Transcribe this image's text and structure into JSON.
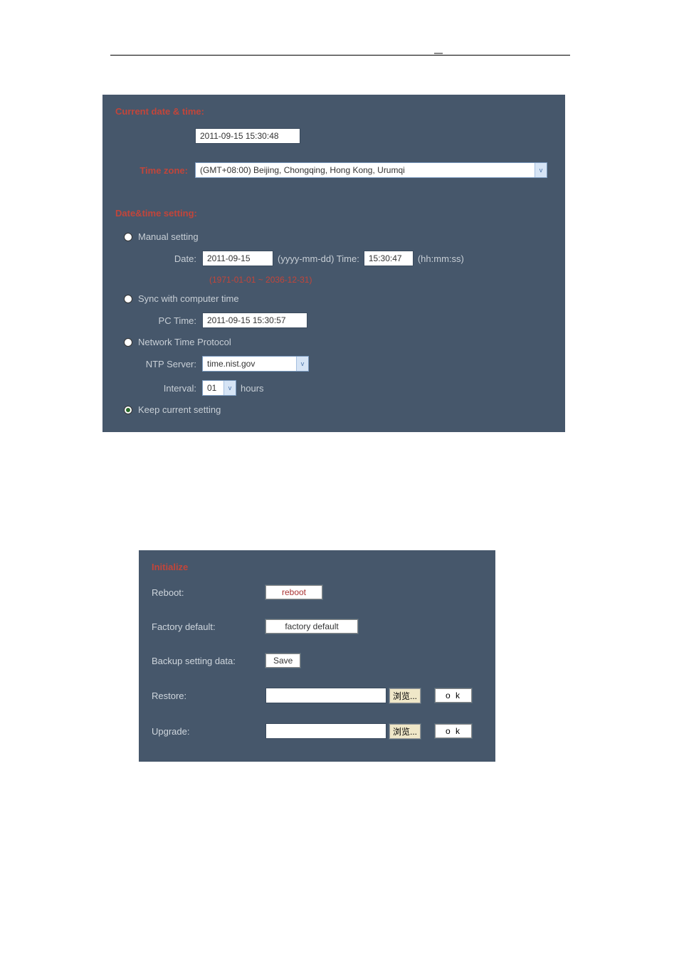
{
  "datetime": {
    "current_title": "Current date & time:",
    "current_value": "2011-09-15 15:30:48",
    "tz_label": "Time zone:",
    "tz_value": "(GMT+08:00) Beijing, Chongqing, Hong Kong, Urumqi",
    "setting_title": "Date&time setting:",
    "manual_label": "Manual setting",
    "date_label": "Date:",
    "date_value": "2011-09-15",
    "date_hint": "(yyyy-mm-dd) Time:",
    "time_value": "15:30:47",
    "time_hint": "(hh:mm:ss)",
    "range_hint": "(1971-01-01 ~ 2036-12-31)",
    "sync_label": "Sync with computer time",
    "pc_time_label": "PC Time:",
    "pc_time_value": "2011-09-15 15:30:57",
    "ntp_label": "Network Time Protocol",
    "ntp_server_label": "NTP Server:",
    "ntp_server_value": "time.nist.gov",
    "interval_label": "Interval:",
    "interval_value": "01",
    "interval_unit": "hours",
    "keep_label": "Keep current setting"
  },
  "init": {
    "title": "Initialize",
    "reboot_label": "Reboot:",
    "reboot_btn": "reboot",
    "factory_label": "Factory default:",
    "factory_btn": "factory default",
    "backup_label": "Backup setting data:",
    "backup_btn": "Save",
    "restore_label": "Restore:",
    "upgrade_label": "Upgrade:",
    "browse_btn": "浏览...",
    "ok_btn": "o k"
  }
}
